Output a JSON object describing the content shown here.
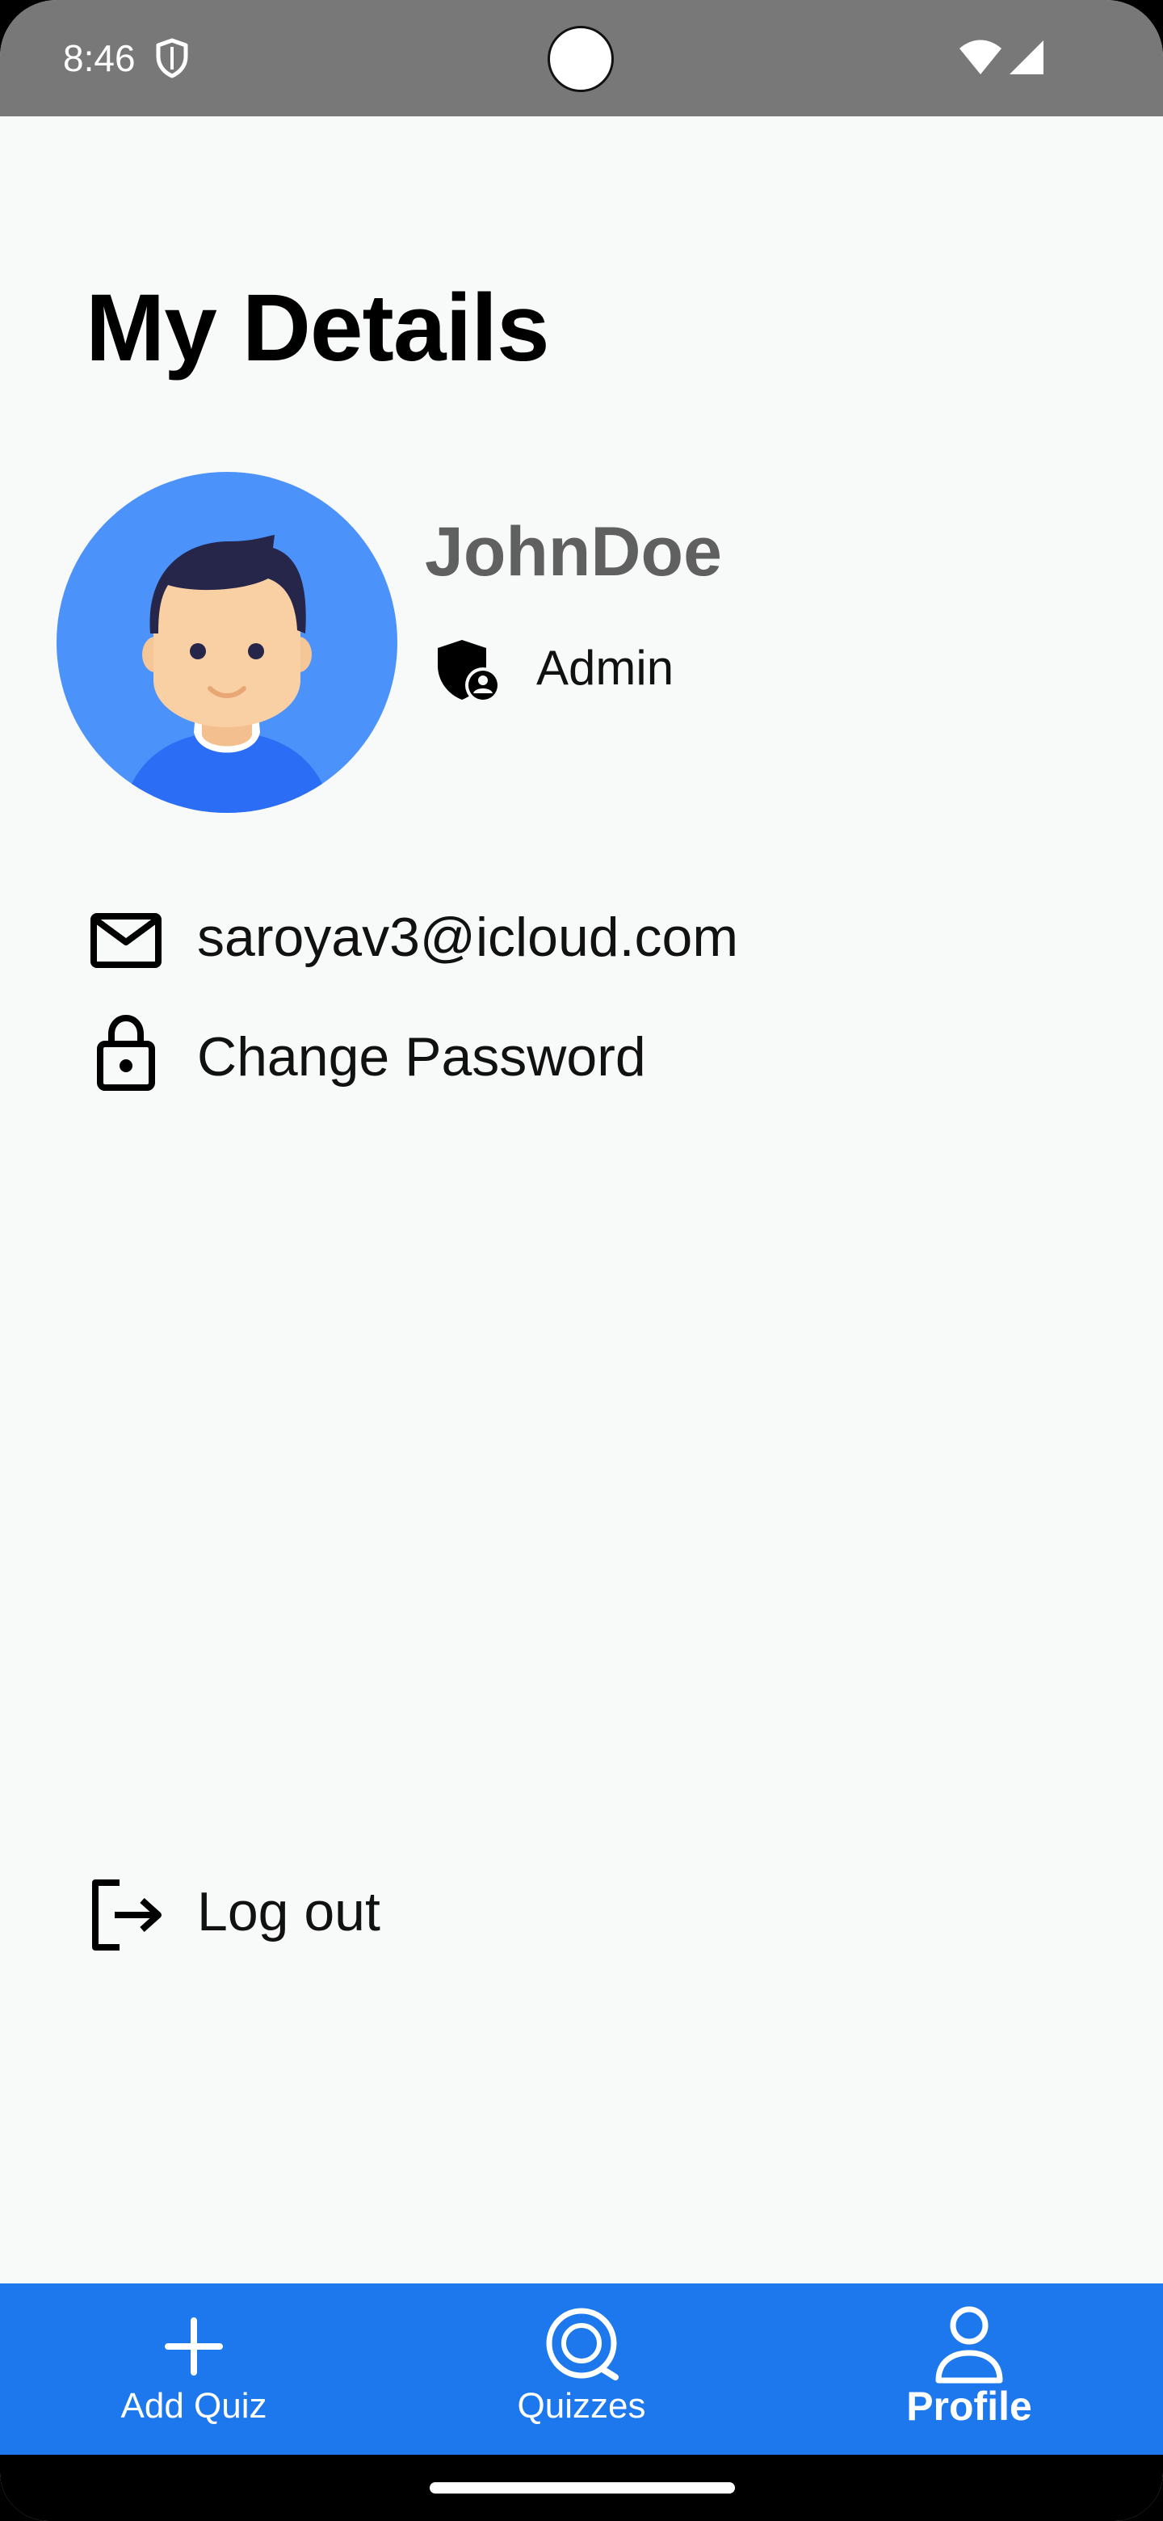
{
  "status_bar": {
    "time": "8:46",
    "icons": [
      "shield-icon",
      "wifi-icon",
      "signal-icon"
    ]
  },
  "page": {
    "title": "My Details"
  },
  "profile": {
    "avatar_icon": "user-avatar",
    "username": "JohnDoe",
    "role_icon": "admin-shield-icon",
    "role": "Admin"
  },
  "details": {
    "email_icon": "mail-icon",
    "email": "saroyav3@icloud.com",
    "password_icon": "lock-icon",
    "change_password_label": "Change Password"
  },
  "actions": {
    "logout_icon": "logout-icon",
    "logout_label": "Log out"
  },
  "bottom_nav": {
    "items": [
      {
        "label": "Add Quiz",
        "icon": "plus-icon",
        "active": false
      },
      {
        "label": "Quizzes",
        "icon": "quiz-bubble-icon",
        "active": false
      },
      {
        "label": "Profile",
        "icon": "person-icon",
        "active": true
      }
    ]
  },
  "colors": {
    "status_bar": "#787878",
    "background": "#f8f9f9",
    "nav_background": "#1d78ee",
    "avatar_background": "#4b92fb",
    "username_text": "#606060"
  }
}
